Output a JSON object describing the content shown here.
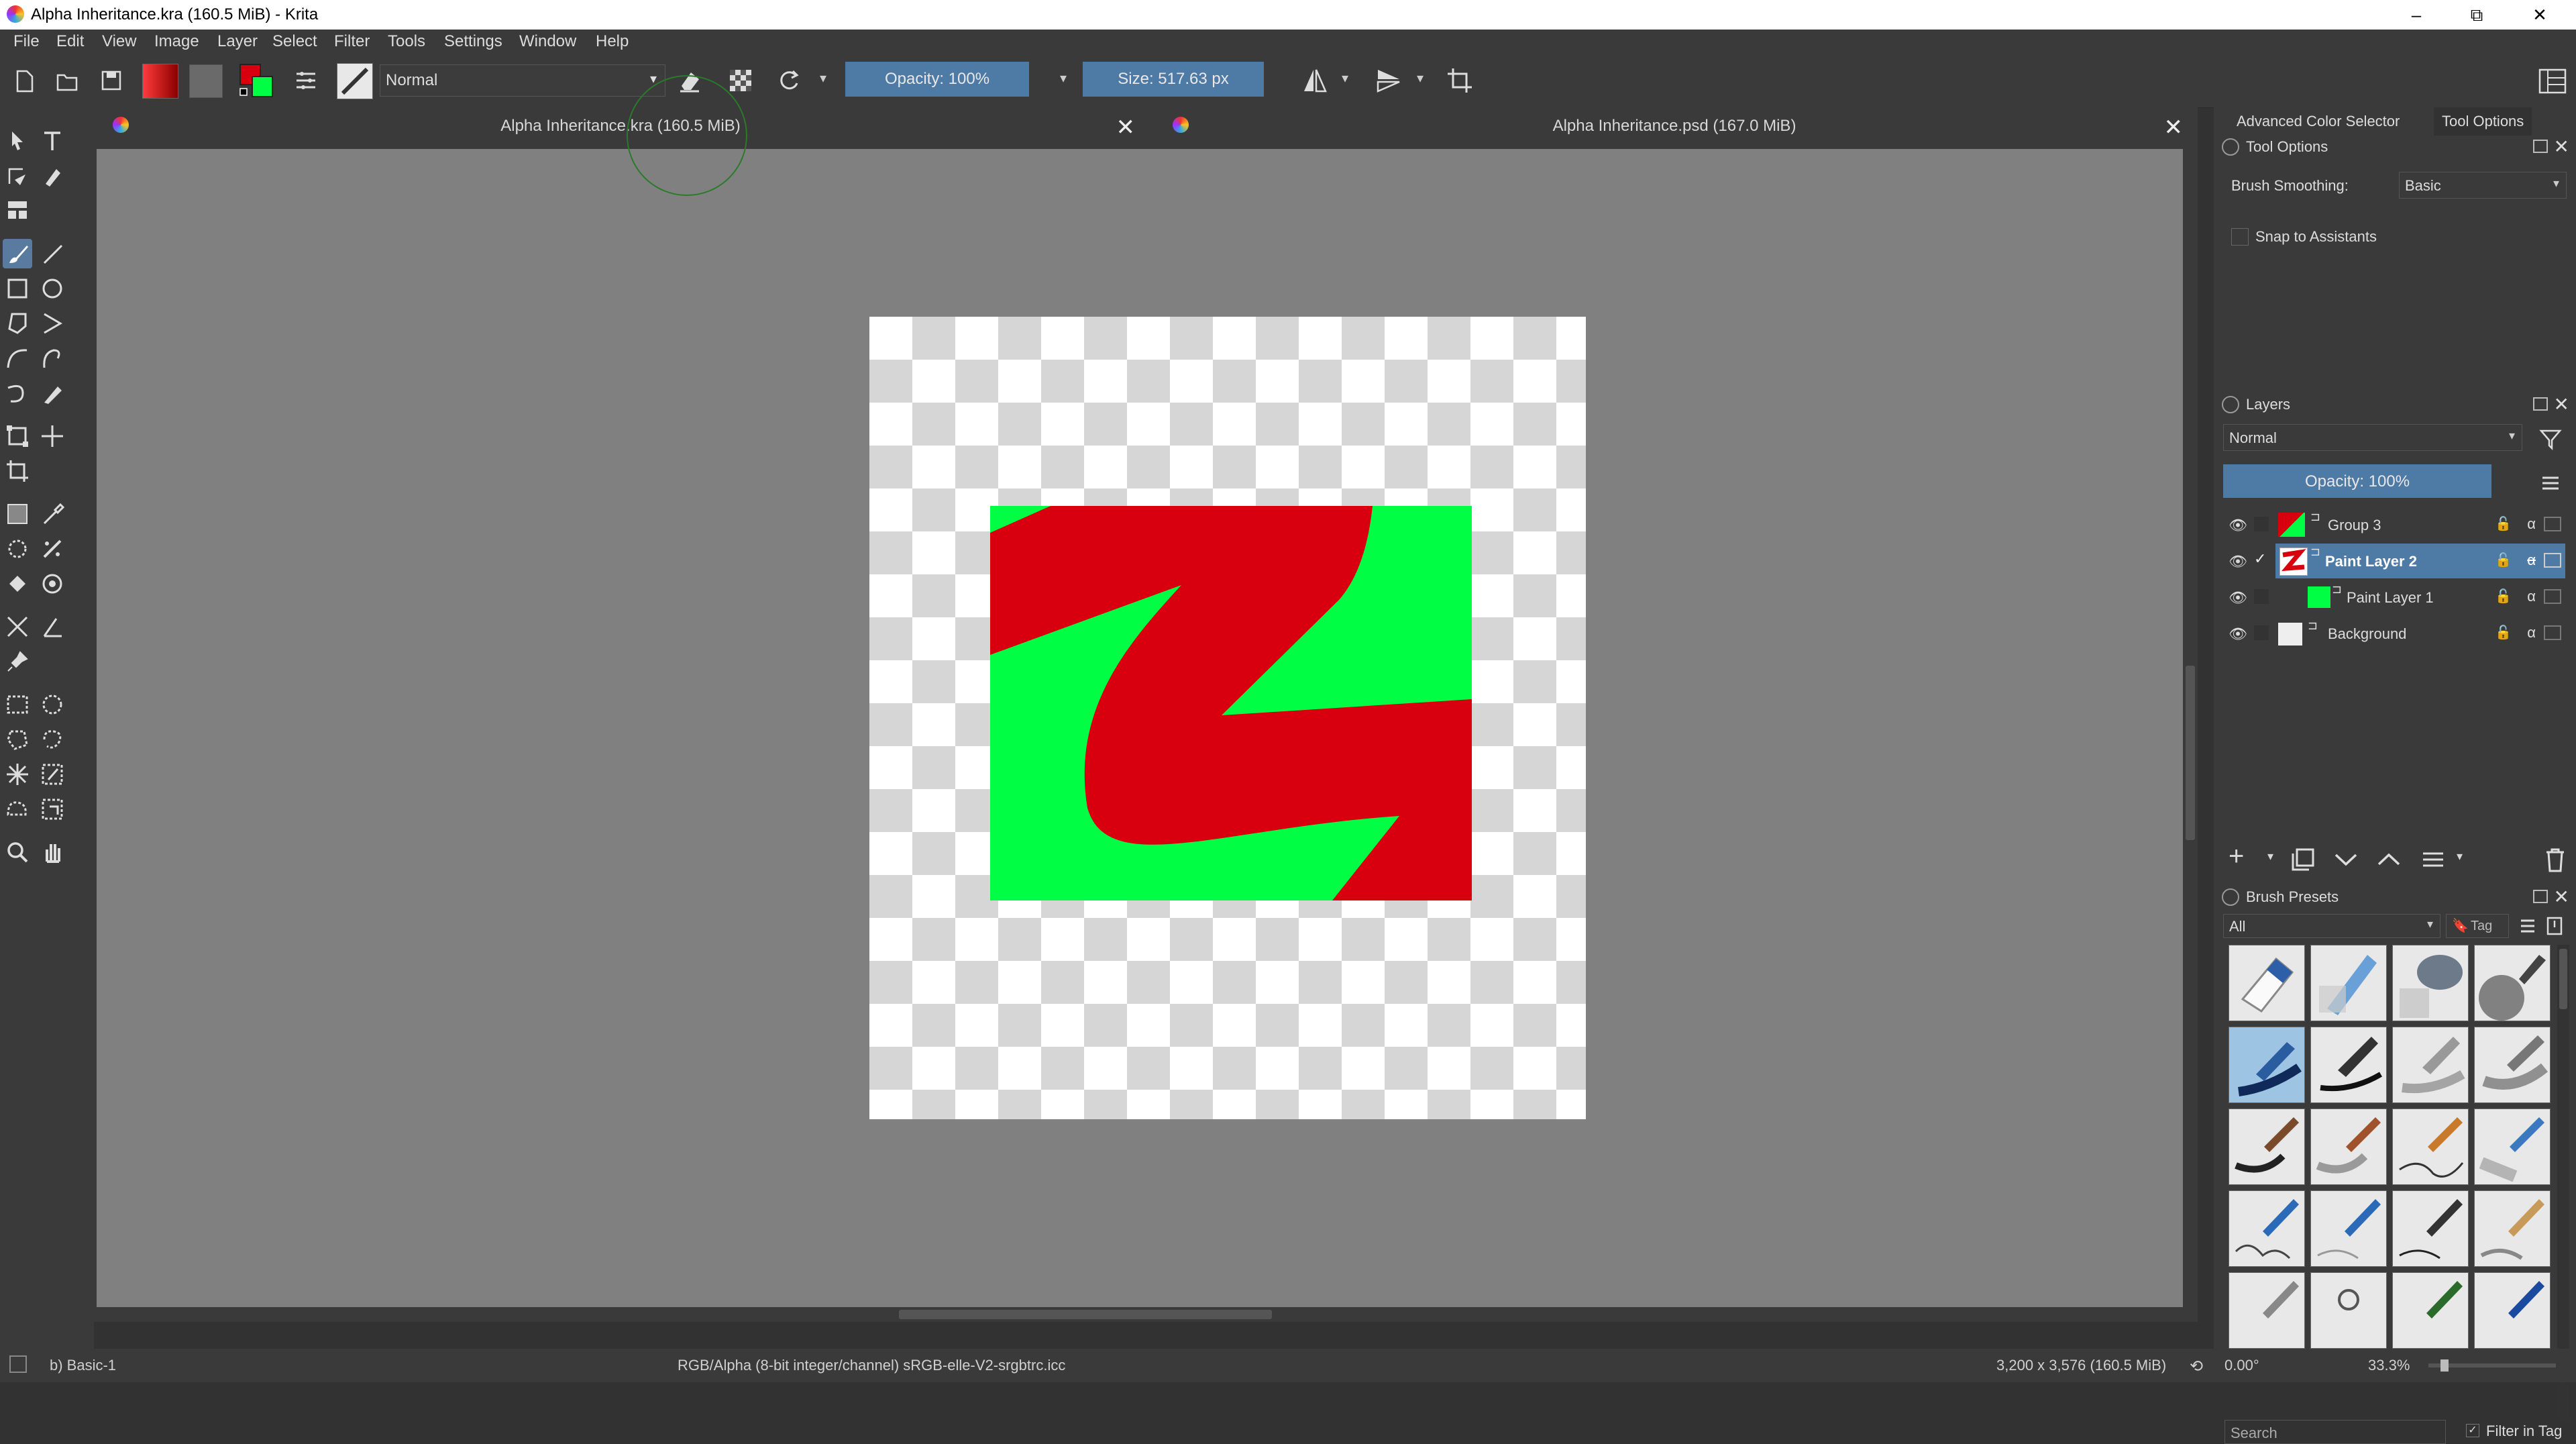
{
  "window": {
    "title": "Alpha Inheritance.kra (160.5 MiB)  - Krita",
    "minimize": "–",
    "maximize": "⧉",
    "close": "✕"
  },
  "menu": [
    "File",
    "Edit",
    "View",
    "Image",
    "Layer",
    "Select",
    "Filter",
    "Tools",
    "Settings",
    "Window",
    "Help"
  ],
  "toolbar": {
    "blend_mode": "Normal",
    "opacity": "Opacity: 100%",
    "size": "Size: 517.63 px"
  },
  "tabs": [
    {
      "label": "Alpha Inheritance.kra (160.5 MiB)",
      "close": "✕"
    },
    {
      "label": "Alpha Inheritance.psd (167.0 MiB)",
      "close": "✕"
    }
  ],
  "docker_tabs": [
    "Advanced Color Selector",
    "Tool Options"
  ],
  "tool_options": {
    "title": "Tool Options",
    "brush_smoothing_label": "Brush Smoothing:",
    "brush_smoothing_value": "Basic",
    "snap_label": "Snap to Assistants"
  },
  "layers": {
    "title": "Layers",
    "blend_mode": "Normal",
    "opacity": "Opacity: 100%",
    "items": [
      {
        "name": "Group 3",
        "selected": false,
        "checked": false
      },
      {
        "name": "Paint Layer 2",
        "selected": true,
        "checked": true
      },
      {
        "name": "Paint Layer 1",
        "selected": false,
        "checked": false
      },
      {
        "name": "Background",
        "selected": false,
        "checked": false
      }
    ]
  },
  "brush_presets": {
    "title": "Brush Presets",
    "filter": "All",
    "tag": "Tag",
    "search_placeholder": "Search",
    "filter_in_tag": "Filter in Tag"
  },
  "status": {
    "preset": "b) Basic-1",
    "color_space": "RGB/Alpha (8-bit integer/channel)  sRGB-elle-V2-srgbtrc.icc",
    "dimensions": "3,200 x 3,576 (160.5 MiB)",
    "rotation": "0.00°",
    "zoom": "33.3%"
  },
  "colors": {
    "red": "#d8000f",
    "green": "#00ff44",
    "accent": "#4e7aa6"
  }
}
